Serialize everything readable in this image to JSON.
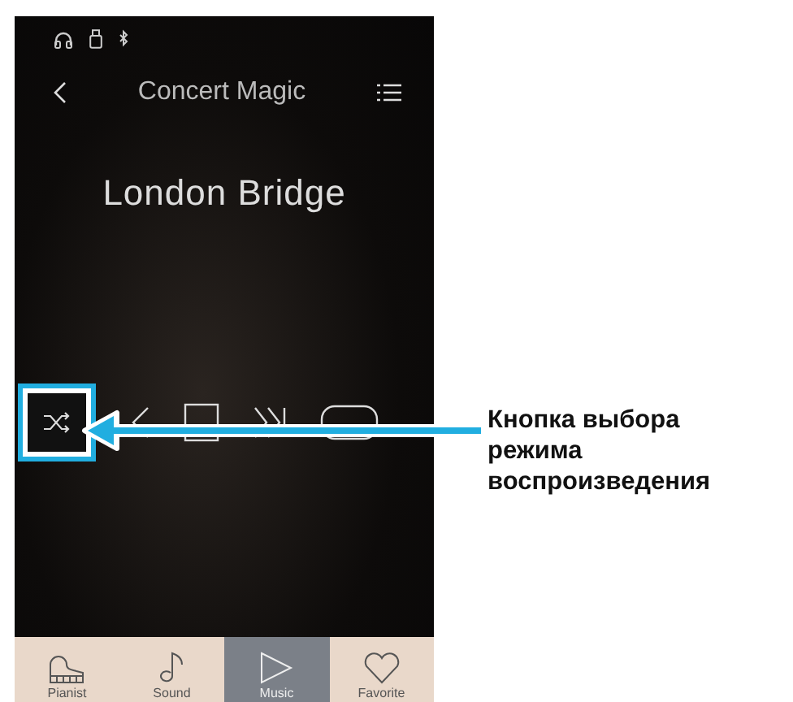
{
  "header": {
    "title": "Concert Magic"
  },
  "song_title": "London Bridge",
  "tabs": [
    {
      "label": "Pianist",
      "kind": "piano",
      "selected": false
    },
    {
      "label": "Sound",
      "kind": "note",
      "selected": false
    },
    {
      "label": "Music",
      "kind": "play",
      "selected": true
    },
    {
      "label": "Favorite",
      "kind": "heart",
      "selected": false
    }
  ],
  "callout": {
    "text": "Кнопка выбора режима воспроизведения"
  }
}
